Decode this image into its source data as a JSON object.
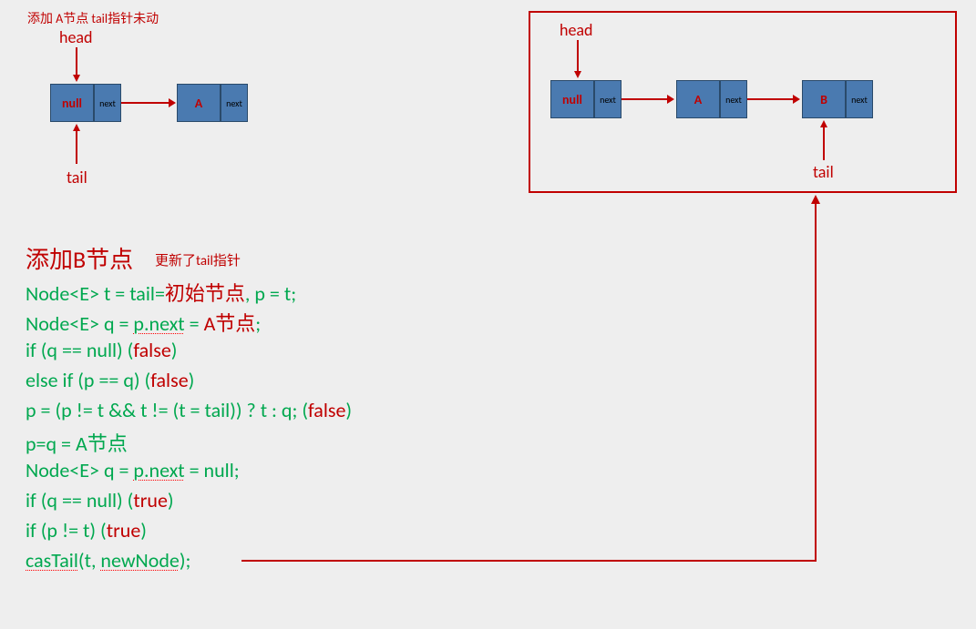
{
  "top_left_diagram": {
    "title": "添加 A节点   tail指针未动",
    "head_label": "head",
    "tail_label": "tail",
    "node1": {
      "value": "null",
      "next": "next"
    },
    "node2": {
      "value": "A",
      "next": "next"
    }
  },
  "top_right_diagram": {
    "head_label": "head",
    "tail_label": "tail",
    "node1": {
      "value": "null",
      "next": "next"
    },
    "node2": {
      "value": "A",
      "next": "next"
    },
    "node3": {
      "value": "B",
      "next": "next"
    }
  },
  "code_block": {
    "title_main": "添加B节点",
    "title_sub": "更新了tail指针",
    "lines": {
      "l1a": "Node<E> t = tail=",
      "l1b": "初始节点",
      "l1c": ", p = t;",
      "l2a": "Node<E> q = ",
      "l2b": "p.next",
      "l2c": " = ",
      "l2d": "A节点",
      "l2e": ";",
      "l3a": "if (q == null)  (",
      "l3b": "false",
      "l3c": ")",
      "l4a": "else if (p == q)  (",
      "l4b": "false",
      "l4c": ")",
      "l5a": "p = (p != t && t != (t = tail)) ? t : q;  (",
      "l5b": "false",
      "l5c": ")",
      "l6a": "p=q = A节点",
      "l7a": "Node<E> q = ",
      "l7b": "p.next",
      "l7c": " = null;",
      "l8a": "if (q == null)  (",
      "l8b": "true",
      "l8c": ")",
      "l9a": "if (p != t)  (",
      "l9b": "true",
      "l9c": ")",
      "l10a": "casTail",
      "l10b": "(t, ",
      "l10c": "newNode",
      "l10d": ");"
    }
  }
}
